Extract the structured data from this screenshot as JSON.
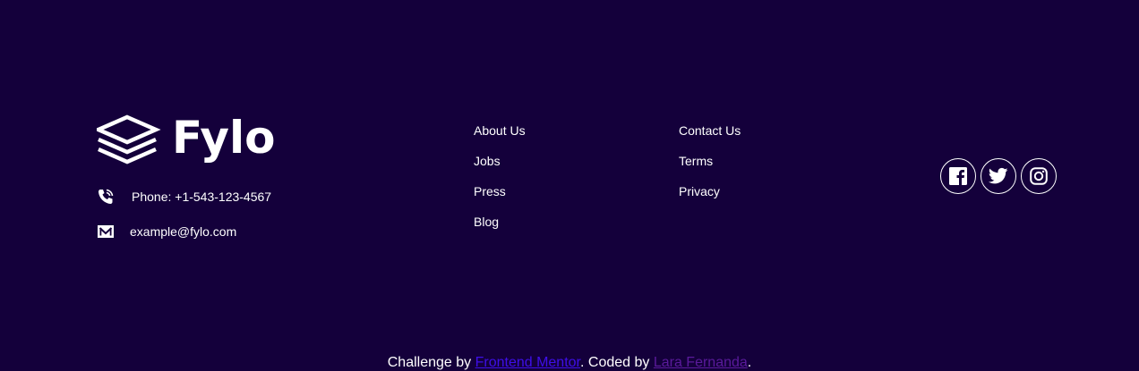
{
  "brand": {
    "name": "Fylo"
  },
  "contact": {
    "phone_label": "Phone: +1-543-123-4567",
    "email": "example@fylo.com"
  },
  "links": {
    "column1": [
      "About Us",
      "Jobs",
      "Press",
      "Blog"
    ],
    "column2": [
      "Contact Us",
      "Terms",
      "Privacy"
    ]
  },
  "social": {
    "icons": [
      "facebook-icon",
      "twitter-icon",
      "instagram-icon"
    ]
  },
  "attribution": {
    "prefix": "Challenge by ",
    "mentor_link": "Frontend Mentor",
    "middle": ". Coded by ",
    "author_link": "Lara Fernanda",
    "suffix": "."
  },
  "colors": {
    "background": "#14003b",
    "text": "#ffffff",
    "mentor_link": "#3e0fe8",
    "author_link": "#5a1a9b"
  }
}
